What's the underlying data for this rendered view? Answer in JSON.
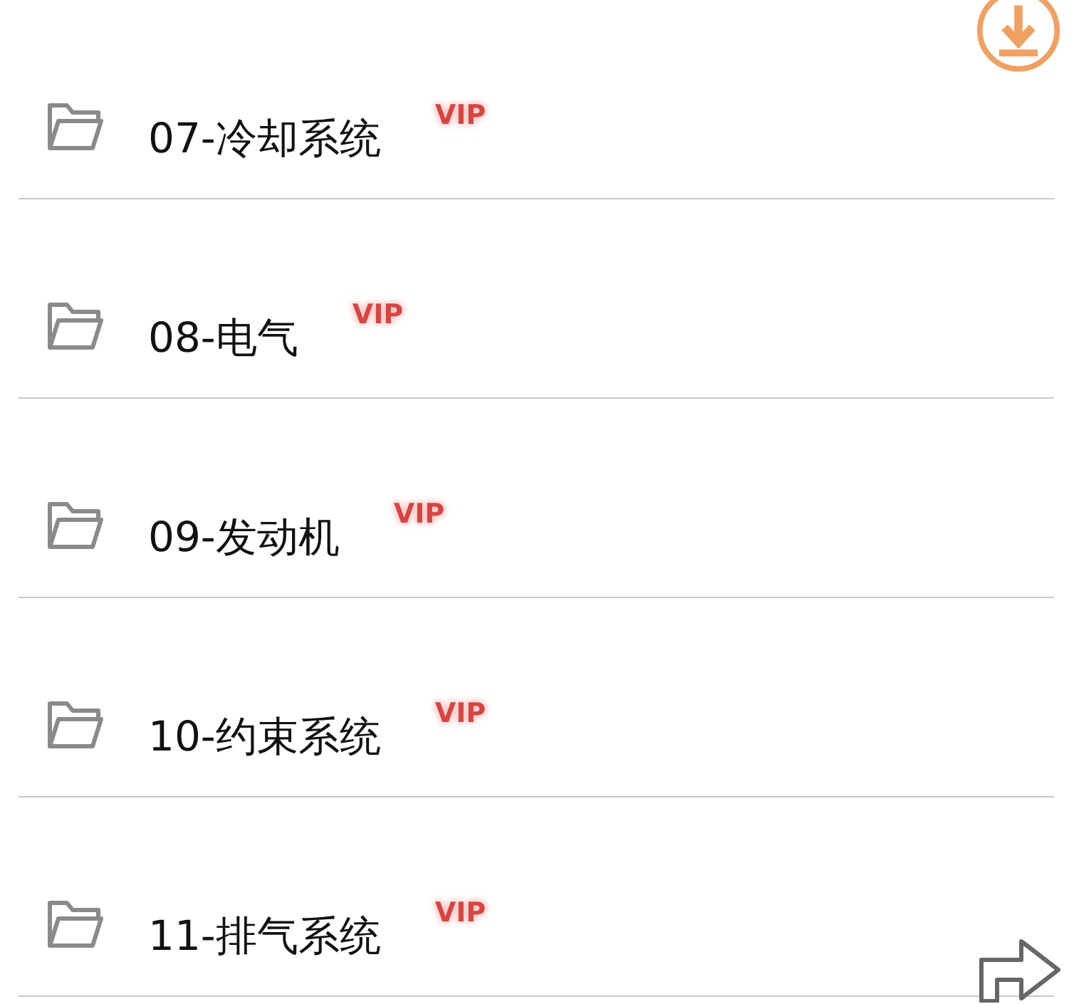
{
  "folders": [
    {
      "name": "07-冷却系统",
      "badge": "VIP"
    },
    {
      "name": "08-电气",
      "badge": "VIP"
    },
    {
      "name": "09-发动机",
      "badge": "VIP"
    },
    {
      "name": "10-约束系统",
      "badge": "VIP"
    },
    {
      "name": "11-排气系统",
      "badge": "VIP"
    }
  ]
}
